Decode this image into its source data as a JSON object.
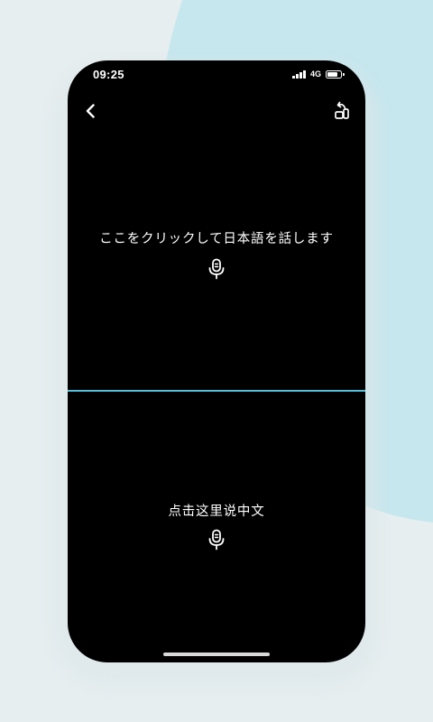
{
  "status_bar": {
    "time": "09:25",
    "network": "4G",
    "signal_icon": "signal-bars-icon",
    "battery_icon": "battery-icon",
    "battery_level": 0.8
  },
  "header": {
    "back_icon": "chevron-left-icon",
    "rotate_icon": "rotate-screen-icon"
  },
  "top_pane": {
    "language": "Japanese",
    "prompt": "ここをクリックして日本語を話します",
    "mic_icon": "microphone-icon"
  },
  "bottom_pane": {
    "language": "Chinese",
    "prompt": "点击这里说中文",
    "mic_icon": "microphone-icon"
  },
  "colors": {
    "page_background": "#e6eef0",
    "accent_circle": "#c6e7ee",
    "screen_background": "#000000",
    "divider": "#55c1dc",
    "text": "#ffffff"
  }
}
